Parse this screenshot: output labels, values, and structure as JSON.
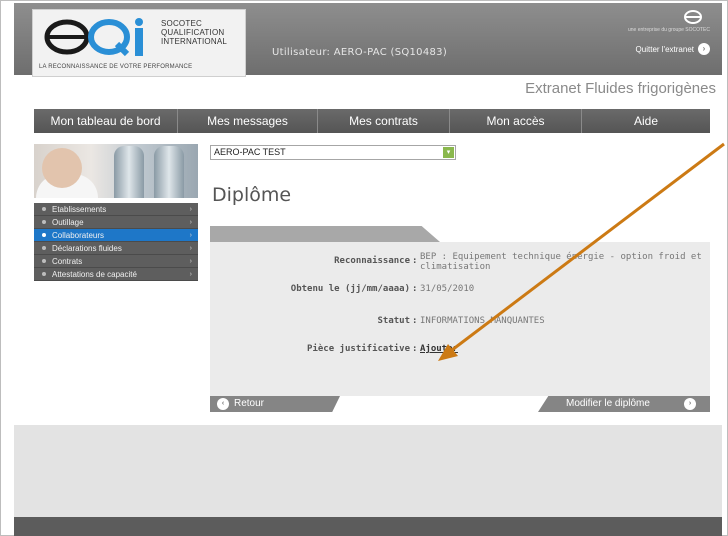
{
  "header": {
    "logo_name": "SOCOTEC QUALIFICATION INTERNATIONAL",
    "logo_line1": "SOCOTEC",
    "logo_line2": "QUALIFICATION",
    "logo_line3": "INTERNATIONAL",
    "logo_tagline": "LA RECONNAISSANCE DE VOTRE PERFORMANCE",
    "user_label": "Utilisateur: AERO-PAC (SQ10483)",
    "group_line": "une entreprise du groupe SOCOTEC",
    "quit_label": "Quitter l'extranet",
    "site_title": "Extranet Fluides frigorigènes"
  },
  "nav": {
    "items": [
      {
        "label": "Mon tableau de bord"
      },
      {
        "label": "Mes messages"
      },
      {
        "label": "Mes contrats"
      },
      {
        "label": "Mon accès"
      },
      {
        "label": "Aide"
      }
    ]
  },
  "sidebar": {
    "items": [
      {
        "label": "Etablissements",
        "active": false
      },
      {
        "label": "Outillage",
        "active": false
      },
      {
        "label": "Collaborateurs",
        "active": true
      },
      {
        "label": "Déclarations fluides",
        "active": false
      },
      {
        "label": "Contrats",
        "active": false
      },
      {
        "label": "Attestations de capacité",
        "active": false
      }
    ],
    "arrow_glyph": "›"
  },
  "main": {
    "company_select_value": "AERO-PAC TEST",
    "page_title": "Diplôme",
    "fields": {
      "reconnaissance_label": "Reconnaissance",
      "reconnaissance_value": "BEP : Equipement technique énergie - option froid et climatisation",
      "date_label": "Obtenu le (jj/mm/aaaa)",
      "date_value": "31/05/2010",
      "statut_label": "Statut",
      "statut_value": "INFORMATIONS MANQUANTES",
      "piece_label": "Pièce justificative",
      "piece_link": "Ajouter",
      "separator": ":"
    },
    "retour_label": "Retour",
    "modifier_label": "Modifier le diplôme"
  },
  "colors": {
    "active_blue": "#1e77c8",
    "annotation_arrow": "#cc7a14",
    "select_button_green": "#8ab84d"
  },
  "icons": {
    "quit_icon": "circle-arrow-right",
    "retour_icon": "circle-arrow-left",
    "modifier_icon": "circle-arrow-right",
    "select_icon": "dropdown-arrow"
  }
}
